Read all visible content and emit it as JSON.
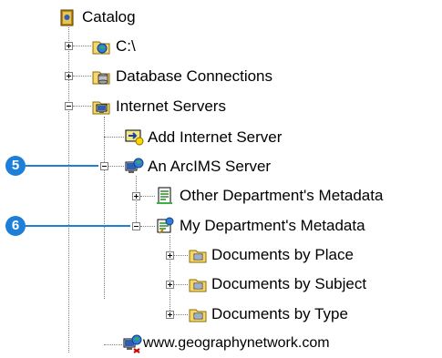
{
  "tree": {
    "root": {
      "label": "Catalog",
      "icon": "catalog-icon"
    },
    "items": [
      {
        "label": "C:\\",
        "icon": "drive-folder-icon",
        "expander": "plus"
      },
      {
        "label": "Database Connections",
        "icon": "database-connections-icon",
        "expander": "plus"
      },
      {
        "label": "Internet Servers",
        "icon": "internet-servers-icon",
        "expander": "minus"
      },
      {
        "label": "Add Internet Server",
        "icon": "add-internet-server-icon"
      },
      {
        "label": "An ArcIMS Server",
        "icon": "arcims-server-icon",
        "expander": "minus"
      },
      {
        "label": "Other Department's Metadata",
        "icon": "metadata-service-icon",
        "expander": "plus"
      },
      {
        "label": "My Department's Metadata",
        "icon": "metadata-service-icon",
        "expander": "minus"
      },
      {
        "label": "Documents by Place",
        "icon": "folder-icon",
        "expander": "plus"
      },
      {
        "label": "Documents by Subject",
        "icon": "folder-icon",
        "expander": "plus"
      },
      {
        "label": "Documents by Type",
        "icon": "folder-icon",
        "expander": "plus"
      },
      {
        "label": "www.geographynetwork.com",
        "icon": "arcims-server-icon"
      }
    ]
  },
  "callouts": [
    {
      "number": "5"
    },
    {
      "number": "6"
    }
  ],
  "colors": {
    "callout": "#1e7fd8",
    "tree_lines": "#808080"
  }
}
